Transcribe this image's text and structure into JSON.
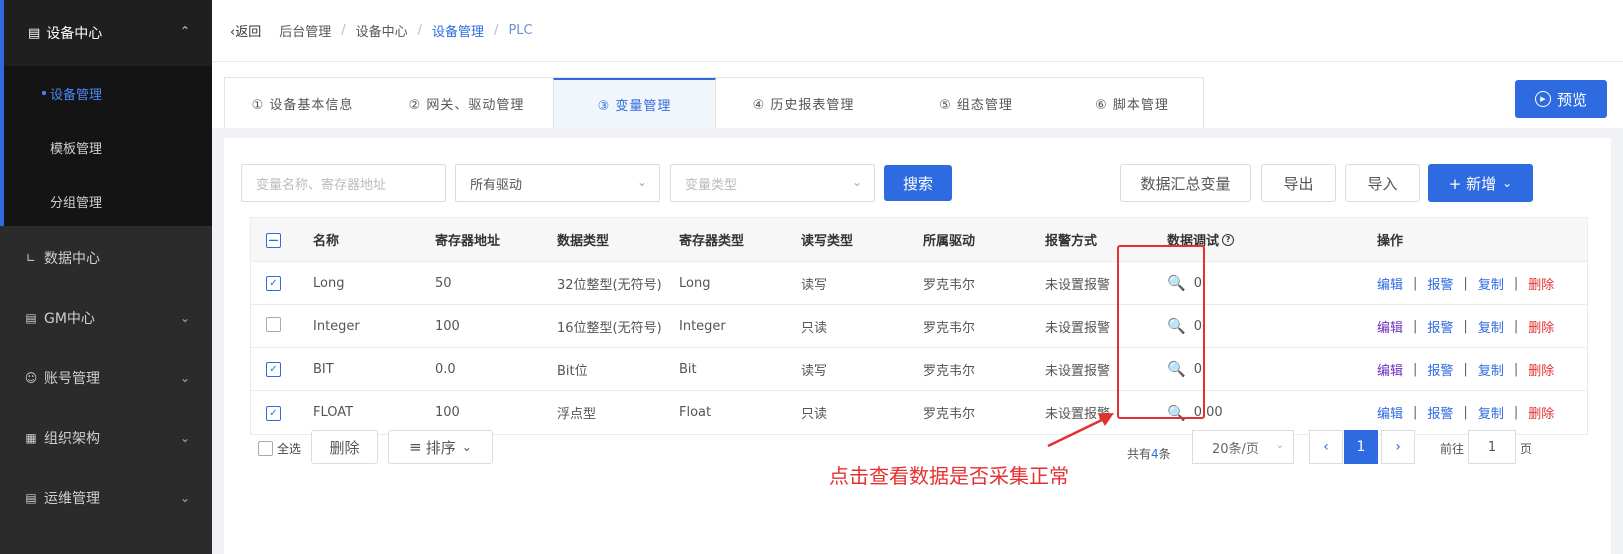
{
  "sidebar": {
    "top": {
      "label": "设备中心"
    },
    "sub_items": [
      {
        "label": "设备管理"
      },
      {
        "label": "模板管理"
      },
      {
        "label": "分组管理"
      }
    ],
    "menu": [
      {
        "label": "数据中心"
      },
      {
        "label": "GM中心"
      },
      {
        "label": "账号管理"
      },
      {
        "label": "组织架构"
      },
      {
        "label": "运维管理"
      }
    ]
  },
  "breadcrumb": {
    "back": "返回",
    "items": [
      "后台管理",
      "设备中心",
      "设备管理",
      "PLC"
    ]
  },
  "tabs": [
    {
      "label": "① 设备基本信息"
    },
    {
      "label": "② 网关、驱动管理"
    },
    {
      "label": "③ 变量管理"
    },
    {
      "label": "④ 历史报表管理"
    },
    {
      "label": "⑤ 组态管理"
    },
    {
      "label": "⑥ 脚本管理"
    }
  ],
  "preview_label": "预览",
  "filters": {
    "name_placeholder": "变量名称、寄存器地址",
    "driver_value": "所有驱动",
    "type_placeholder": "变量类型"
  },
  "toolbar": {
    "search": "搜索",
    "summary": "数据汇总变量",
    "export": "导出",
    "import": "导入",
    "add": "+ 新增"
  },
  "table": {
    "headers": [
      "名称",
      "寄存器地址",
      "数据类型",
      "寄存器类型",
      "读写类型",
      "所属驱动",
      "报警方式",
      "数据调试",
      "操作"
    ],
    "rows": [
      {
        "name": "Long",
        "addr": "50",
        "dtype": "32位整型(无符号)",
        "rtype": "Long",
        "rw": "读写",
        "driver": "罗克韦尔",
        "alarm": "未设置报警",
        "debug": "0"
      },
      {
        "name": "Integer",
        "addr": "100",
        "dtype": "16位整型(无符号)",
        "rtype": "Integer",
        "rw": "只读",
        "driver": "罗克韦尔",
        "alarm": "未设置报警",
        "debug": "0"
      },
      {
        "name": "BIT",
        "addr": "0.0",
        "dtype": "Bit位",
        "rtype": "Bit",
        "rw": "读写",
        "driver": "罗克韦尔",
        "alarm": "未设置报警",
        "debug": "0"
      },
      {
        "name": "FLOAT",
        "addr": "100",
        "dtype": "浮点型",
        "rtype": "Float",
        "rw": "只读",
        "driver": "罗克韦尔",
        "alarm": "未设置报警",
        "debug": "0.00"
      }
    ],
    "ops": {
      "edit": "编辑",
      "alarm": "报警",
      "copy": "复制",
      "delete": "删除"
    }
  },
  "footer": {
    "select_all": "全选",
    "delete": "删除",
    "sort": "排序",
    "total_prefix": "共有",
    "total_count": "4",
    "total_suffix": "条",
    "page_size": "20条/页",
    "current_page": "1",
    "goto_label": "前往",
    "goto_value": "1",
    "goto_unit": "页"
  },
  "annotation": "点击查看数据是否采集正常",
  "colors": {
    "accent": "#2f6be0",
    "danger": "#e03131",
    "annotation": "#e53030"
  }
}
